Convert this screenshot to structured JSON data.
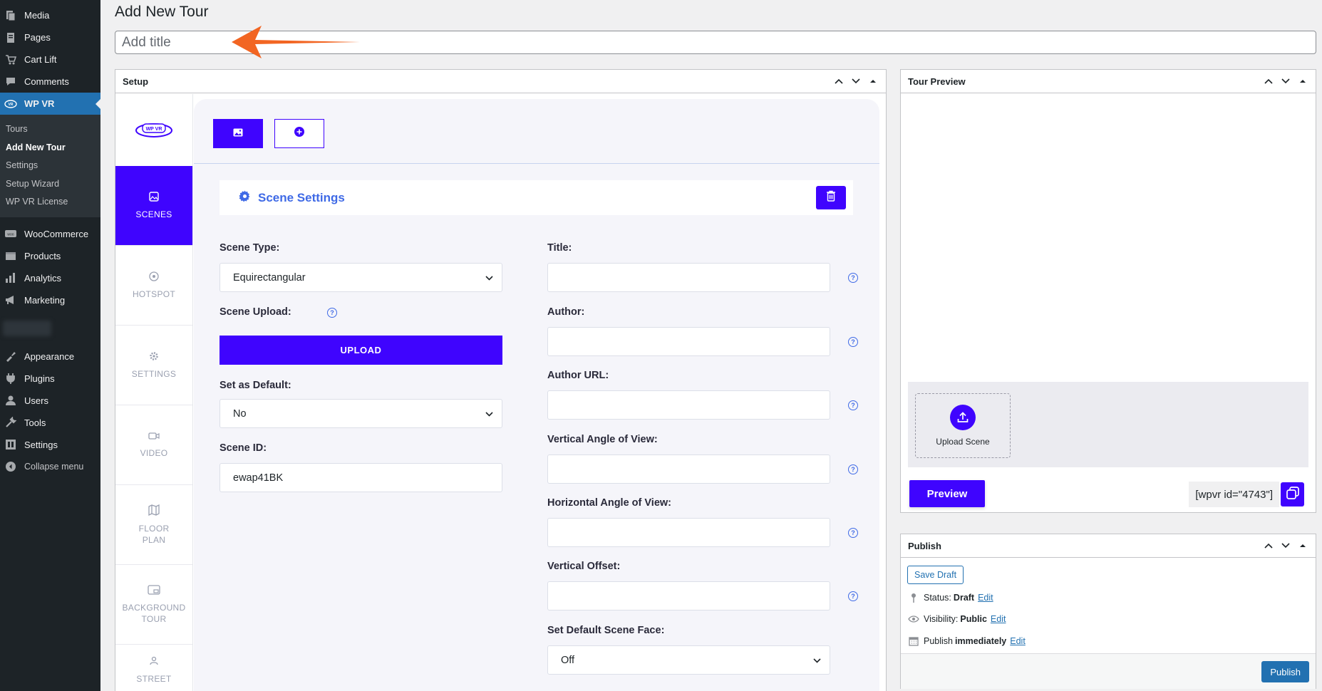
{
  "sidebar": {
    "items": [
      {
        "label": "Media",
        "icon": "media-icon"
      },
      {
        "label": "Pages",
        "icon": "pages-icon"
      },
      {
        "label": "Cart Lift",
        "icon": "cart-icon"
      },
      {
        "label": "Comments",
        "icon": "comments-icon"
      },
      {
        "label": "WP VR",
        "icon": "wpvr-icon"
      }
    ],
    "submenu": [
      "Tours",
      "Add New Tour",
      "Settings",
      "Setup Wizard",
      "WP VR License"
    ],
    "items2": [
      {
        "label": "WooCommerce",
        "icon": "woo-icon"
      },
      {
        "label": "Products",
        "icon": "products-icon"
      },
      {
        "label": "Analytics",
        "icon": "analytics-icon"
      },
      {
        "label": "Marketing",
        "icon": "marketing-icon"
      }
    ],
    "items3": [
      {
        "label": "Appearance",
        "icon": "appearance-icon"
      },
      {
        "label": "Plugins",
        "icon": "plugins-icon"
      },
      {
        "label": "Users",
        "icon": "users-icon"
      },
      {
        "label": "Tools",
        "icon": "tools-icon"
      },
      {
        "label": "Settings",
        "icon": "settings-icon"
      }
    ],
    "collapse": "Collapse menu"
  },
  "page": {
    "title": "Add New Tour",
    "title_placeholder": "Add title"
  },
  "setup": {
    "header": "Setup",
    "logo_text": "WP VR",
    "tabs": [
      {
        "label": "SCENES",
        "line2": ""
      },
      {
        "label": "HOTSPOT",
        "line2": ""
      },
      {
        "label": "SETTINGS",
        "line2": ""
      },
      {
        "label": "VIDEO",
        "line2": ""
      },
      {
        "label": "FLOOR",
        "line2": "PLAN"
      },
      {
        "label": "BACKGROUND",
        "line2": "TOUR"
      },
      {
        "label": "STREET",
        "line2": ""
      }
    ],
    "scene_settings_title": "Scene Settings",
    "left_fields": {
      "scene_type_label": "Scene Type:",
      "scene_type_value": "Equirectangular",
      "scene_upload_label": "Scene Upload:",
      "upload_button": "UPLOAD",
      "set_default_label": "Set as Default:",
      "set_default_value": "No",
      "scene_id_label": "Scene ID:",
      "scene_id_value": "ewap41BK"
    },
    "right_fields": {
      "title_label": "Title:",
      "author_label": "Author:",
      "author_url_label": "Author URL:",
      "vertical_aov_label": "Vertical Angle of View:",
      "horizontal_aov_label": "Horizontal Angle of View:",
      "vertical_offset_label": "Vertical Offset:",
      "default_face_label": "Set Default Scene Face:",
      "default_face_value": "Off"
    }
  },
  "tour_preview": {
    "header": "Tour Preview",
    "upload_scene": "Upload Scene",
    "preview_button": "Preview",
    "shortcode": "[wpvr id=\"4743\"]"
  },
  "publish": {
    "header": "Publish",
    "save_draft": "Save Draft",
    "status_label": "Status:",
    "status_value": "Draft",
    "visibility_label": "Visibility:",
    "visibility_value": "Public",
    "publish_label": "Publish",
    "publish_value": "immediately",
    "edit": "Edit",
    "publish_button": "Publish"
  },
  "colors": {
    "accent": "#3f04fe",
    "wp_blue": "#2271b1",
    "annotation_arrow": "#f26522"
  }
}
